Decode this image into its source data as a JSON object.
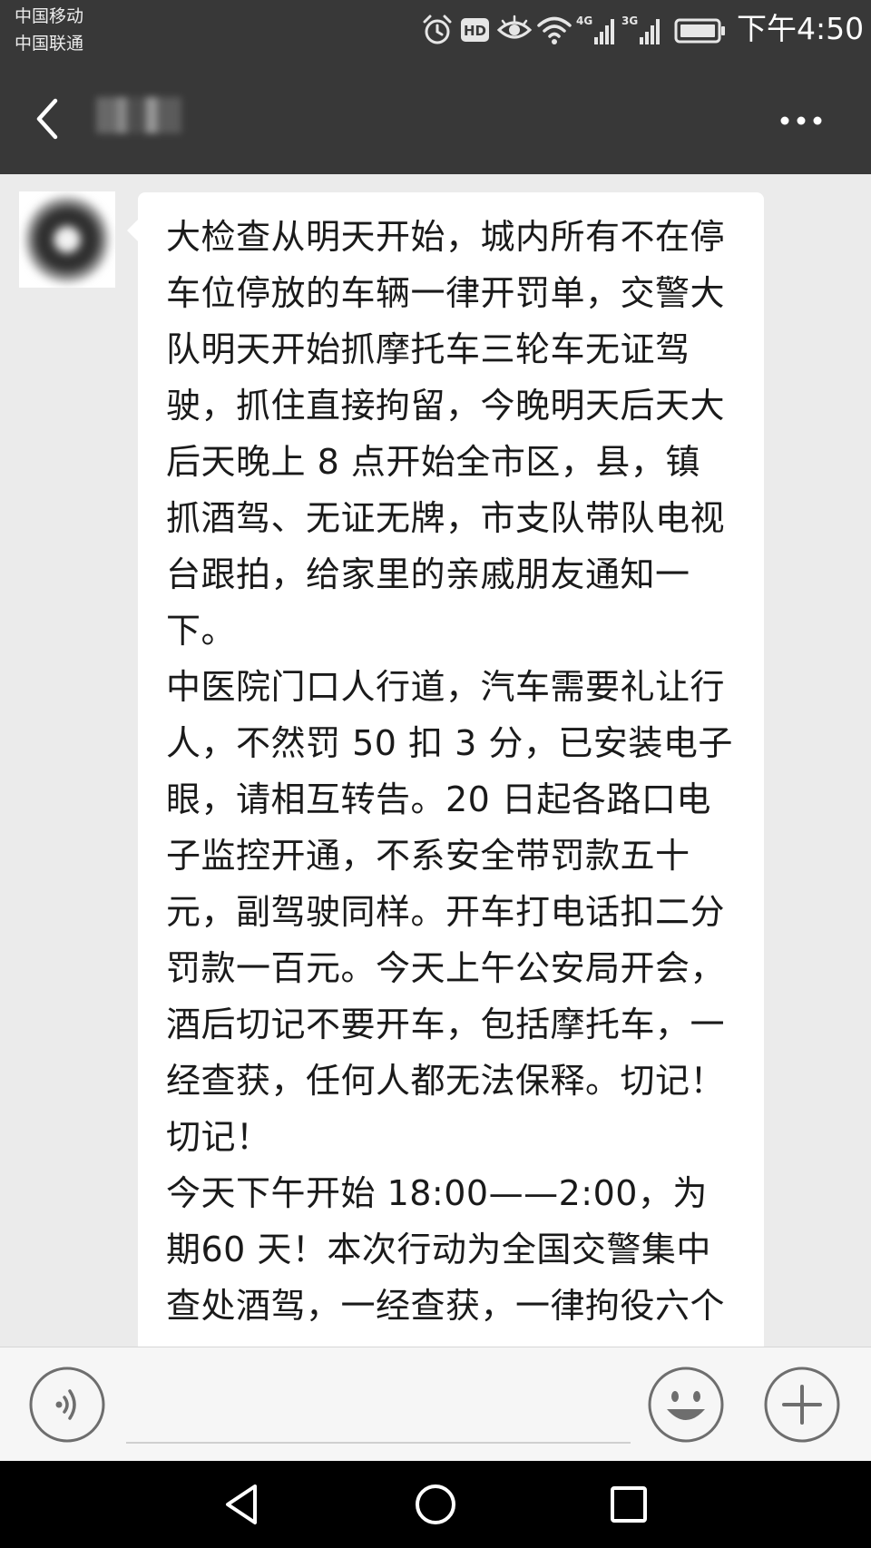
{
  "status_bar": {
    "carrier_1": "中国移动",
    "carrier_2": "中国联通",
    "hd_label": "HD",
    "signal_1_label": "4G",
    "signal_2_label": "3G",
    "time": "下午4:50",
    "icons": [
      "alarm-icon",
      "hd-icon",
      "eye-icon",
      "wifi-icon",
      "signal-4g-icon",
      "signal-3g-icon",
      "battery-icon"
    ]
  },
  "title_bar": {
    "back_icon": "chevron-left-icon",
    "more_icon": "more-dots-icon"
  },
  "message": {
    "paragraphs": [
      "大检查从明天开始，城内所有不在停车位停放的车辆一律开罚单，交警大队明天开始抓摩托车三轮车无证驾驶，抓住直接拘留，今晚明天后天大后天晚上 8 点开始全市区，县，镇 抓酒驾、无证无牌，市支队带队电视台跟拍，给家里的亲戚朋友通知一下。",
      "中医院门口人行道，汽车需要礼让行人，不然罚 50 扣 3 分，已安装电子眼，请相互转告。20 日起各路口电子监控开通，不系安全带罚款五十元，副驾驶同样。开车打电话扣二分罚款一百元。今天上午公安局开会，酒后切记不要开车，包括摩托车，一经查获，任何人都无法保释。切记！切记！",
      "今天下午开始 18:00——2:00，为期60 天！本次行动为全国交警集中查处酒驾，一经查获，一律拘役六个"
    ]
  },
  "input_bar": {
    "voice_icon": "voice-icon",
    "input_value": "",
    "emoji_icon": "emoji-icon",
    "plus_icon": "plus-icon"
  },
  "nav_bar": {
    "icons": [
      "nav-back-icon",
      "nav-home-icon",
      "nav-recent-icon"
    ]
  },
  "colors": {
    "header_bg": "#383838",
    "chat_bg": "#ebebeb",
    "bubble_bg": "#ffffff",
    "nav_bg": "#000000"
  }
}
